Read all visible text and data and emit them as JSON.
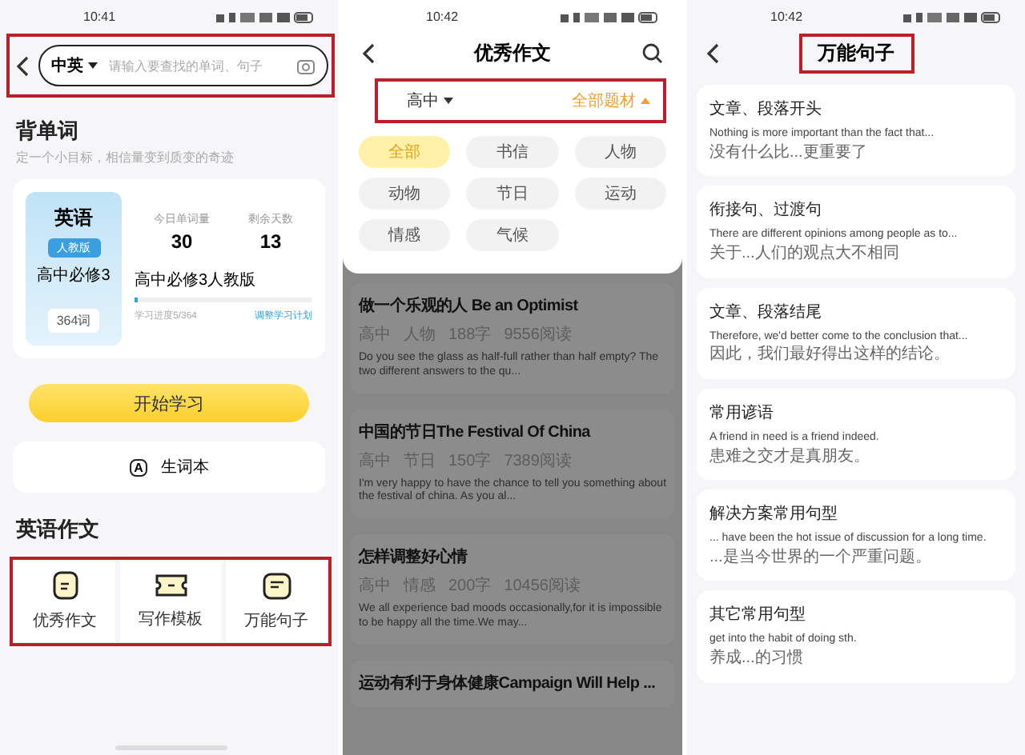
{
  "left_screen": {
    "status_bar": {
      "time": "10:41"
    },
    "search": {
      "language": "中英",
      "placeholder": "请输入要查找的单词、句子",
      "highlighted": true
    },
    "vocab": {
      "title": "背单词",
      "subtitle": "定一个小目标，相信量变到质变的奇迹",
      "book": {
        "subject": "英语",
        "edition": "人教版",
        "name": "高中必修3",
        "count": "364词"
      },
      "stats": [
        {
          "label": "今日单词量",
          "value": "30"
        },
        {
          "label": "剩余天数",
          "value": "13"
        }
      ],
      "plan_name": "高中必修3人教版",
      "level": 0.014,
      "progress": "学习进度5/364",
      "adjust_link": "调整学习计划"
    },
    "start_button": "开始学习",
    "wordbook": {
      "icon_letter": "A",
      "label": "生词本"
    },
    "essay": {
      "title": "英语作文",
      "highlighted": true,
      "tools": [
        {
          "kind": "essay",
          "label": "优秀作文"
        },
        {
          "kind": "template",
          "label": "写作模板"
        },
        {
          "kind": "sentence",
          "label": "万能句子"
        }
      ]
    }
  },
  "middle_screen": {
    "status_bar": {
      "time": "10:42"
    },
    "title": "优秀作文",
    "filters": {
      "highlighted": true,
      "items": [
        {
          "label": "高中",
          "expanded": false
        },
        {
          "label": "全部题材",
          "expanded": true
        }
      ]
    },
    "chips": [
      {
        "label": "全部",
        "selected": true
      },
      {
        "label": "书信",
        "selected": false
      },
      {
        "label": "人物",
        "selected": false
      },
      {
        "label": "动物",
        "selected": false
      },
      {
        "label": "节日",
        "selected": false
      },
      {
        "label": "运动",
        "selected": false
      },
      {
        "label": "情感",
        "selected": false
      },
      {
        "label": "气候",
        "selected": false
      }
    ],
    "articles": [
      {
        "title": "做一个乐观的人 Be an Optimist",
        "meta": [
          "高中",
          "人物",
          "188字",
          "9556阅读"
        ],
        "excerpt": "Do you see the glass as half-full rather than half empty? The two different answers to the qu..."
      },
      {
        "title": "中国的节日The Festival Of China",
        "meta": [
          "高中",
          "节日",
          "150字",
          "7389阅读"
        ],
        "excerpt": "I'm very happy to have the chance to tell you something about the festival of china. As you al..."
      },
      {
        "title": "怎样调整好心情",
        "meta": [
          "高中",
          "情感",
          "200字",
          "10456阅读"
        ],
        "excerpt": "We all experience bad moods occasionally,for it is impossible to be happy all the time.We may..."
      },
      {
        "title": "运动有利于身体健康Campaign Will Help ..."
      }
    ]
  },
  "right_screen": {
    "status_bar": {
      "time": "10:42"
    },
    "title": "万能句子",
    "title_highlighted": true,
    "sections": [
      {
        "title": "文章、段落开头",
        "lines": [
          "Nothing is more important than the fact that...",
          "没有什么比...更重要了"
        ]
      },
      {
        "title": "衔接句、过渡句",
        "lines": [
          "There are different opinions among people as to...",
          "关于...人们的观点大不相同"
        ]
      },
      {
        "title": "文章、段落结尾",
        "lines": [
          "Therefore, we'd better come to the conclusion that...",
          "因此，我们最好得出这样的结论。"
        ]
      },
      {
        "title": "常用谚语",
        "lines": [
          "A friend in need is a friend indeed.",
          "患难之交才是真朋友。"
        ]
      },
      {
        "title": "解决方案常用句型",
        "lines": [
          "... have been the hot issue of discussion for a long time.",
          "...是当今世界的一个严重问题。"
        ]
      },
      {
        "title": "其它常用句型",
        "lines": [
          "get into the habit of doing sth.",
          "养成...的习惯"
        ]
      }
    ]
  }
}
